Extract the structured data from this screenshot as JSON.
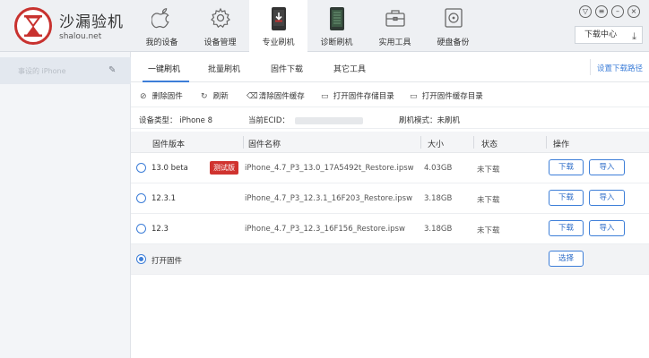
{
  "app": {
    "title": "沙漏验机",
    "domain": "shalou.net"
  },
  "nav": [
    {
      "label": "我的设备",
      "icon": "apple-icon"
    },
    {
      "label": "设备管理",
      "icon": "gear-icon"
    },
    {
      "label": "专业刷机",
      "icon": "phone-flash-icon"
    },
    {
      "label": "诊断刷机",
      "icon": "chip-icon"
    },
    {
      "label": "实用工具",
      "icon": "toolbox-icon"
    },
    {
      "label": "硬盘备份",
      "icon": "disk-icon"
    }
  ],
  "window": {
    "download_center": "下载中心"
  },
  "sidebar": {
    "device_name": "事设的 iPhone"
  },
  "tabs": [
    "一键刷机",
    "批量刷机",
    "固件下载",
    "其它工具"
  ],
  "settings_link": "设置下载路径",
  "toolbar": [
    {
      "label": "删除固件",
      "icon": "delete-icon"
    },
    {
      "label": "刷新",
      "icon": "refresh-icon"
    },
    {
      "label": "清除固件缓存",
      "icon": "broom-icon"
    },
    {
      "label": "打开固件存储目录",
      "icon": "folder-icon"
    },
    {
      "label": "打开固件缓存目录",
      "icon": "folder-icon"
    }
  ],
  "info": {
    "device_type_label": "设备类型：",
    "device_type": "iPhone 8",
    "ecid_label": "当前ECID：",
    "mode_label": "刷机模式：",
    "mode": "未刷机"
  },
  "table": {
    "headers": [
      "固件版本",
      "固件名称",
      "大小",
      "状态",
      "操作"
    ],
    "rows": [
      {
        "version": "13.0 beta",
        "badge": "测试版",
        "name": "iPhone_4.7_P3_13.0_17A5492t_Restore.ipsw",
        "size": "4.03GB",
        "status": "未下载",
        "download": "下载",
        "import": "导入",
        "checked": false
      },
      {
        "version": "12.3.1",
        "badge": "",
        "name": "iPhone_4.7_P3_12.3.1_16F203_Restore.ipsw",
        "size": "3.18GB",
        "status": "未下载",
        "download": "下载",
        "import": "导入",
        "checked": false
      },
      {
        "version": "12.3",
        "badge": "",
        "name": "iPhone_4.7_P3_12.3_16F156_Restore.ipsw",
        "size": "3.18GB",
        "status": "未下载",
        "download": "下载",
        "import": "导入",
        "checked": false
      }
    ],
    "open_row": {
      "label": "打开固件",
      "button": "选择",
      "checked": true
    }
  },
  "colors": {
    "accent": "#3d7ed8",
    "brand": "#c8322f",
    "badge": "#d0332f"
  }
}
